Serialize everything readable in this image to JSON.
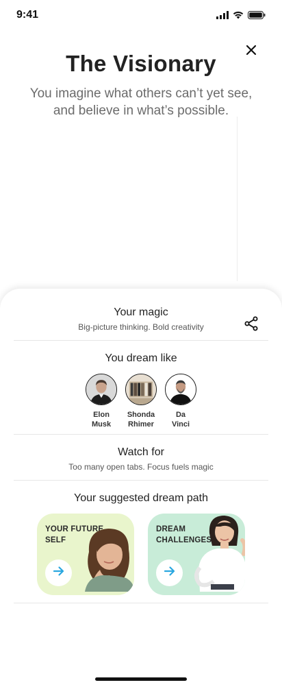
{
  "status_bar": {
    "time": "9:41"
  },
  "hero": {
    "title": "The Visionary",
    "subtitle": "You imagine what others can’t yet see, and believe in what’s possible."
  },
  "magic": {
    "title": "Your magic",
    "subtitle": "Big-picture thinking. Bold creativity"
  },
  "dream_like": {
    "title": "You dream like",
    "people": [
      {
        "first": "Elon",
        "last": "Musk"
      },
      {
        "first": "Shonda",
        "last": "Rhimer"
      },
      {
        "first": "Da",
        "last": "Vinci"
      }
    ]
  },
  "watch_for": {
    "title": "Watch for",
    "subtitle": "Too many open tabs. Focus fuels magic"
  },
  "dream_path": {
    "title": "Your suggested dream path",
    "cards": [
      {
        "label": "YOUR FUTURE SELF",
        "color": "#e9f5cc"
      },
      {
        "label": "DREAM CHALLENGES",
        "color": "#c8ecd8"
      }
    ]
  },
  "colors": {
    "arrow": "#2aa7e0",
    "text": "#222222",
    "muted": "#6b6b6b"
  },
  "icons": [
    "signal-icon",
    "wifi-icon",
    "battery-icon",
    "close-icon",
    "share-icon",
    "arrow-right-icon"
  ]
}
